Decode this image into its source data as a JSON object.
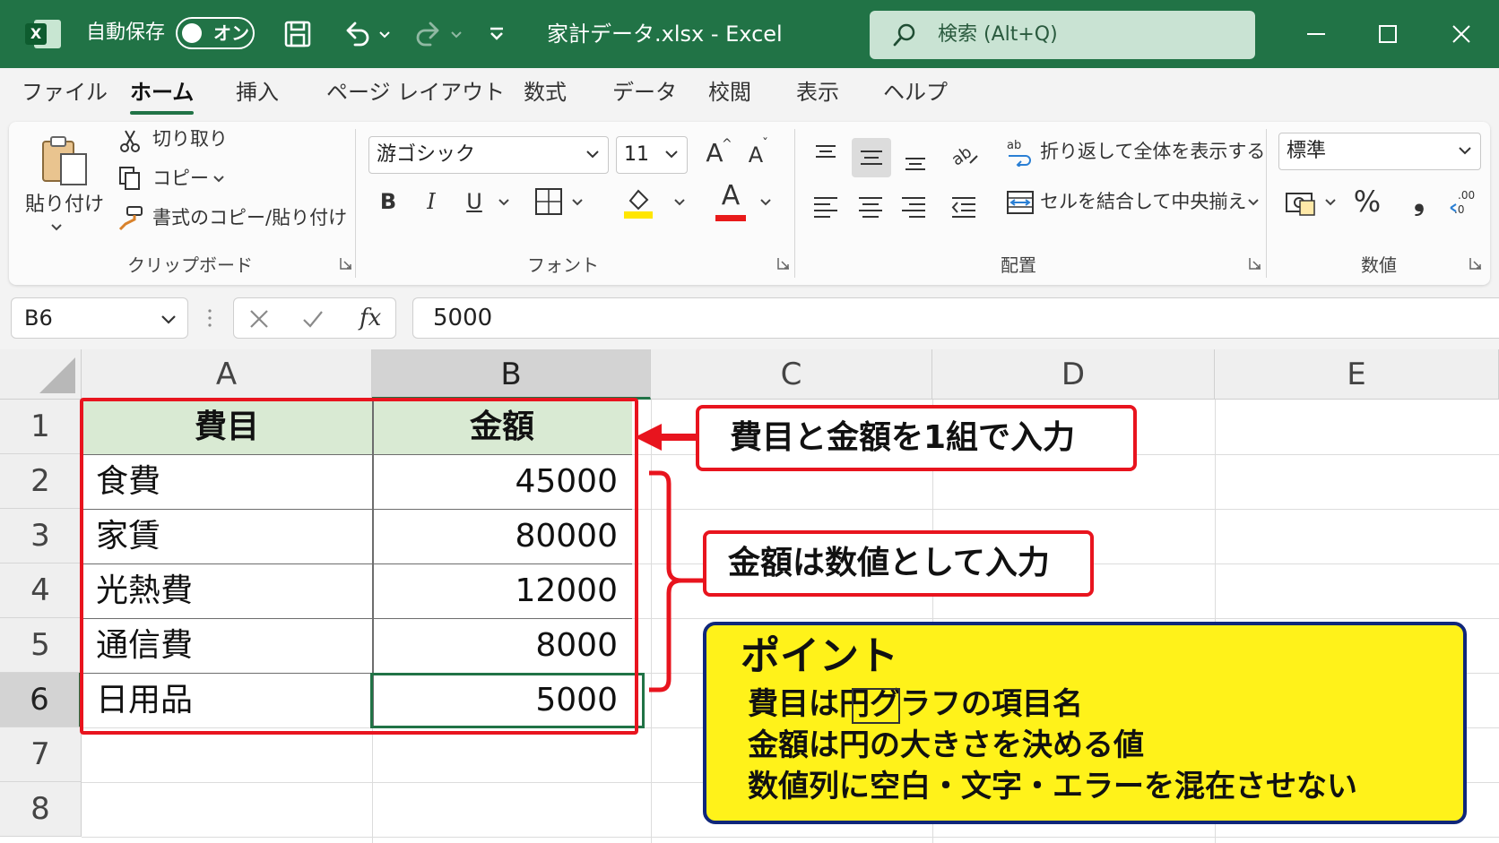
{
  "titlebar": {
    "autosave_label": "自動保存",
    "autosave_state": "オン",
    "file_title": "家計データ.xlsx  -  Excel",
    "search_text": "検索 (Alt+Q)",
    "bg_color": "#217346"
  },
  "menu": {
    "tabs": [
      "ファイル",
      "ホーム",
      "挿入",
      "ページ レイアウト",
      "数式",
      "データ",
      "校閲",
      "表示",
      "ヘルプ"
    ],
    "active": "ホーム"
  },
  "ribbon": {
    "clipboard": {
      "paste": "貼り付け",
      "cut": "切り取り",
      "copy": "コピー",
      "format_painter": "書式のコピー/貼り付け",
      "group_label": "クリップボード"
    },
    "font": {
      "name": "游ゴシック",
      "size": "11",
      "grow": "A",
      "shrink": "A",
      "bold": "B",
      "italic": "I",
      "underline": "U",
      "font_color_letter": "A",
      "group_label": "フォント"
    },
    "alignment": {
      "wrap_text": "折り返して全体を表示する",
      "merge_center": "セルを結合して中央揃え",
      "group_label": "配置"
    },
    "number": {
      "format": "標準",
      "percent": "%",
      "comma": "❟",
      "group_label": "数値"
    }
  },
  "formula_bar": {
    "name_box": "B6",
    "fx": "fx",
    "value": "5000"
  },
  "sheet": {
    "columns": [
      "A",
      "B",
      "C",
      "D",
      "E"
    ],
    "rows": [
      "1",
      "2",
      "3",
      "4",
      "5",
      "6",
      "7",
      "8"
    ],
    "selected_cell": "B6",
    "header_fill": "#d9ead3",
    "headers": [
      "費目",
      "金額"
    ],
    "data": [
      {
        "category": "食費",
        "amount": "45000"
      },
      {
        "category": "家賃",
        "amount": "80000"
      },
      {
        "category": "光熱費",
        "amount": "12000"
      },
      {
        "category": "通信費",
        "amount": "8000"
      },
      {
        "category": "日用品",
        "amount": "5000"
      }
    ]
  },
  "annotations": {
    "callout1": "費目と金額を1組で入力",
    "callout2": "金額は数値として入力",
    "point_title": "ポイント",
    "point_lines": [
      "費目は円グラフの項目名",
      "金額は円の大きさを決める値",
      "数値列に空白・文字・エラーを混在させない"
    ],
    "red": "#e8141e",
    "note_fill": "#fff21a",
    "note_border": "#10277a"
  }
}
